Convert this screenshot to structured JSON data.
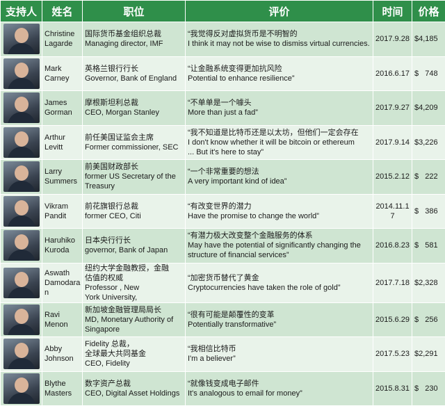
{
  "headers": {
    "supporter": "支持人",
    "name": "姓名",
    "position": "职位",
    "comment": "评价",
    "time": "时间",
    "price": "价格"
  },
  "rows": [
    {
      "name": "Christine\nLagarde",
      "position_cn": "国际货币基金组织总裁",
      "position_en": "Managing director, IMF",
      "quote_cn": "“我觉得反对虚拟货币是不明智的",
      "quote_en": "I think it may not be wise to dismiss virtual currencies.",
      "date": "2017.9.28",
      "price": "$4,185"
    },
    {
      "name": "Mark\nCarney",
      "position_cn": "英格兰银行行长",
      "position_en": "Governor, Bank of England",
      "quote_cn": "“让金融系统变得更加抗风险",
      "quote_en": "Potential to enhance resilience”",
      "date": "2016.6.17",
      "price": "$   748"
    },
    {
      "name": "James\nGorman",
      "position_cn": "摩根斯坦利总裁",
      "position_en": "CEO, Morgan Stanley",
      "quote_cn": "“不单单是一个噱头",
      "quote_en": "More than just a fad”",
      "date": "2017.9.27",
      "price": "$4,209"
    },
    {
      "name": "Arthur\nLevitt",
      "position_cn": "前任美国证监会主席",
      "position_en": "Former commissioner, SEC",
      "quote_cn": "“我不知道是比特币还是以太坊，但他们一定会存在",
      "quote_en": "I don't know whether it will be bitcoin or ethereum\n... But it's here to stay”",
      "date": "2017.9.14",
      "price": "$3,226"
    },
    {
      "name": "Larry\nSummers",
      "position_cn": "前美国财政部长",
      "position_en": "former US Secretary of the\nTreasury",
      "quote_cn": "“一个非常重要的想法",
      "quote_en": "A very important kind of idea”",
      "date": "2015.2.12",
      "price": "$   222"
    },
    {
      "name": "Vikram\nPandit",
      "position_cn": "前花旗银行总裁",
      "position_en": "former CEO, Citi",
      "quote_cn": "“有改变世界的潜力",
      "quote_en": "Have the promise to change the world”",
      "date": "2014.11.1\n7",
      "price": "$   386"
    },
    {
      "name": "Haruhiko\nKuroda",
      "position_cn": "日本央行行长",
      "position_en": "governor, Bank of Japan",
      "quote_cn": "“有潜力极大改变整个金融服务的体系",
      "quote_en": "May have the potential of significantly changing the\nstructure of financial services”",
      "date": "2016.8.23",
      "price": "$   581"
    },
    {
      "name": "Aswath\nDamodara\nn",
      "position_cn": "纽约大学金融教授，金融\n估值的权威",
      "position_en": "Professor , New\nYork University,",
      "quote_cn": "“加密货币替代了黄金",
      "quote_en": "Cryptocurrencies have taken the role of gold”",
      "date": "2017.7.18",
      "price": "$2,328"
    },
    {
      "name": "Ravi\nMenon",
      "position_cn": "新加坡金融管理局局长",
      "position_en": "MD, Monetary Authority of\nSingapore",
      "quote_cn": "“很有可能是颠覆性的变革",
      "quote_en": "Potentially transformative”",
      "date": "2015.6.29",
      "price": "$   256"
    },
    {
      "name": "Abby\nJohnson",
      "position_cn": "Fidelity 总裁，\n全球最大共同基金",
      "position_en": "CEO, Fidelity",
      "quote_cn": "“我相信比特币",
      "quote_en": "I'm a believer”",
      "date": "2017.5.23",
      "price": "$2,291"
    },
    {
      "name": "Blythe\nMasters",
      "position_cn": "数字资产总裁",
      "position_en": "CEO, Digital Asset Holdings",
      "quote_cn": "“就像钱变成电子邮件",
      "quote_en": "It's analogous to email for money”",
      "date": "2015.8.31",
      "price": "$   230"
    }
  ]
}
